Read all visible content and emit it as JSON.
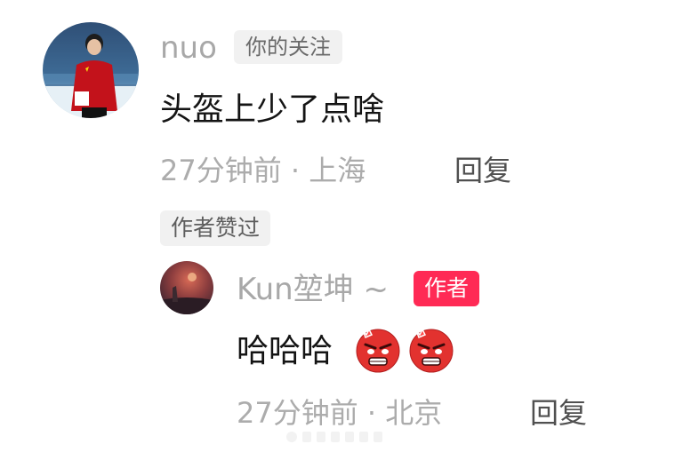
{
  "comment": {
    "username": "nuo",
    "follow_badge": "你的关注",
    "text": "头盔上少了点啥",
    "time_location": "27分钟前 · 上海",
    "reply_label": "回复",
    "liked_by_author": "作者赞过"
  },
  "reply": {
    "username": "Kun堃坤 ~",
    "author_badge": "作者",
    "text": "哈哈哈",
    "emojis": [
      "angry-face-icon",
      "angry-face-icon"
    ],
    "time_location": "27分钟前 · 北京",
    "reply_label": "回复"
  },
  "colors": {
    "author_badge": "#ff2a55",
    "username": "#a8a8a8",
    "meta": "#acacac"
  }
}
